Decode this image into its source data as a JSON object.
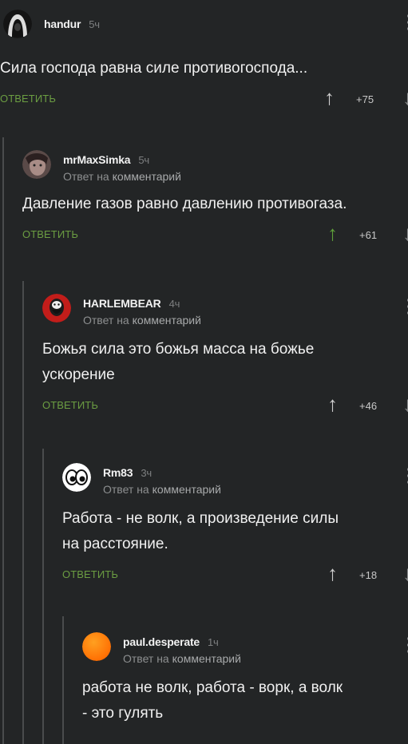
{
  "comments": [
    {
      "author": "handur",
      "time": "5ч",
      "reply_to_prefix": "",
      "reply_to_link": "",
      "text_lines": [
        "Сила господа равна силе противогоспода..."
      ],
      "reply_label": "ОТВЕТИТЬ",
      "rating": "+75",
      "vote_up_active": false,
      "avatar_colors": [
        "#111111",
        "#e5e5e5"
      ]
    },
    {
      "author": "mrMaxSimka",
      "time": "5ч",
      "reply_to_prefix": "Ответ на",
      "reply_to_link": "комментарий",
      "text_lines": [
        "Давление газов равно давлению противогаза."
      ],
      "reply_label": "ОТВЕТИТЬ",
      "rating": "+61",
      "vote_up_active": true,
      "avatar_colors": [
        "#8b6f6d",
        "#2a2a2a"
      ]
    },
    {
      "author": "HARLEMBEAR",
      "time": "4ч",
      "reply_to_prefix": "Ответ на",
      "reply_to_link": "комментарий",
      "text_lines": [
        "Божья сила это божья масса на божье",
        "ускорение"
      ],
      "reply_label": "ОТВЕТИТЬ",
      "rating": "+46",
      "vote_up_active": false,
      "avatar_colors": [
        "#c8201c",
        "#1a1a1a"
      ]
    },
    {
      "author": "Rm83",
      "time": "3ч",
      "reply_to_prefix": "Ответ на",
      "reply_to_link": "комментарий",
      "text_lines": [
        "Работа - не волк, а произведение силы",
        "на расстояние."
      ],
      "reply_label": "ОТВЕТИТЬ",
      "rating": "+18",
      "vote_up_active": false,
      "avatar_colors": [
        "#ffffff",
        "#000000"
      ]
    },
    {
      "author": "paul.desperate",
      "time": "1ч",
      "reply_to_prefix": "Ответ на",
      "reply_to_link": "комментарий",
      "text_lines": [
        "работа не волк, работа - ворк, а волк",
        "- это гулять"
      ],
      "reply_label": "",
      "rating": "",
      "vote_up_active": false,
      "avatar_colors": [
        "#ff7a00",
        "#ffa020"
      ]
    }
  ],
  "icons": {
    "vote_up": "↑",
    "vote_down": "↓"
  },
  "colors": {
    "background": "#232526",
    "reply_link": "#6b9d42",
    "vote_up_active": "#5fa23a"
  }
}
